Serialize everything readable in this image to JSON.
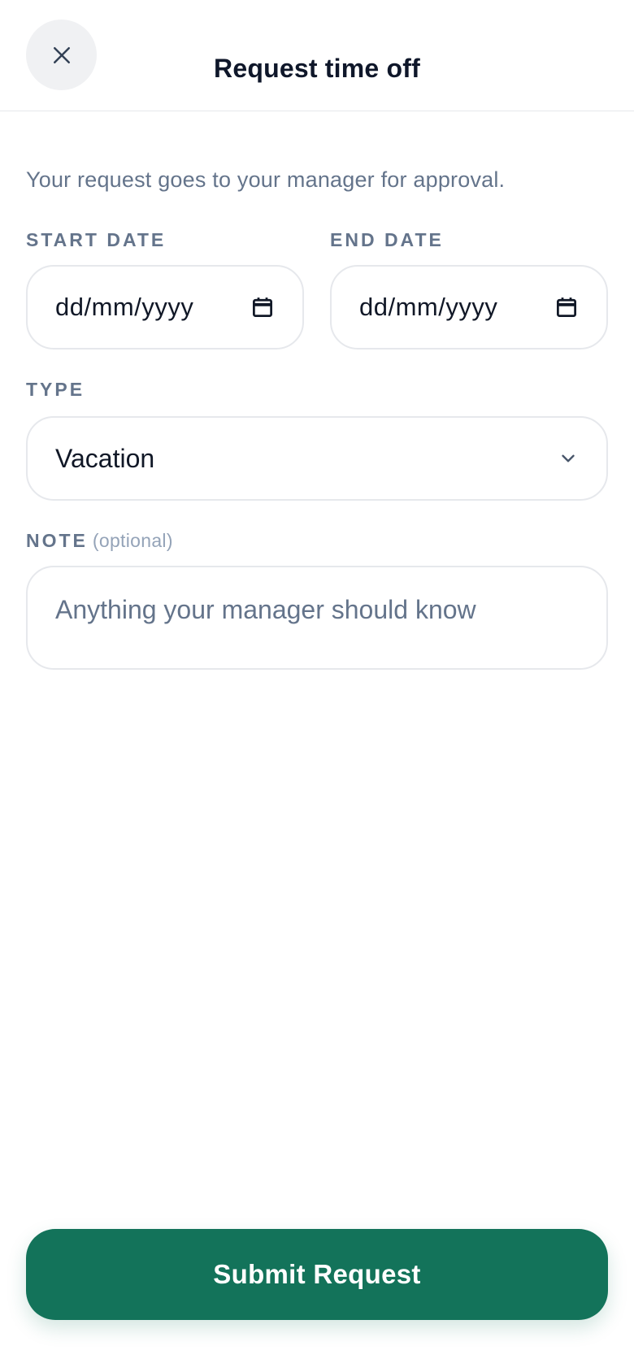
{
  "header": {
    "title": "Request time off",
    "close_icon": "close-icon"
  },
  "intro": "Your request goes to your manager for approval.",
  "form": {
    "start_date": {
      "label": "START DATE",
      "value": "dd/mm/yyyy",
      "icon": "calendar-icon"
    },
    "end_date": {
      "label": "END DATE",
      "value": "dd/mm/yyyy",
      "icon": "calendar-icon"
    },
    "type": {
      "label": "TYPE",
      "value": "Vacation",
      "icon": "chevron-down-icon"
    },
    "note": {
      "label": "NOTE",
      "optional": "(optional)",
      "placeholder": "Anything your manager should know"
    }
  },
  "submit_label": "Submit Request",
  "colors": {
    "accent": "#13735a",
    "muted_text": "#64748b",
    "border": "#e6e8ec",
    "close_bg": "#f0f1f3"
  }
}
